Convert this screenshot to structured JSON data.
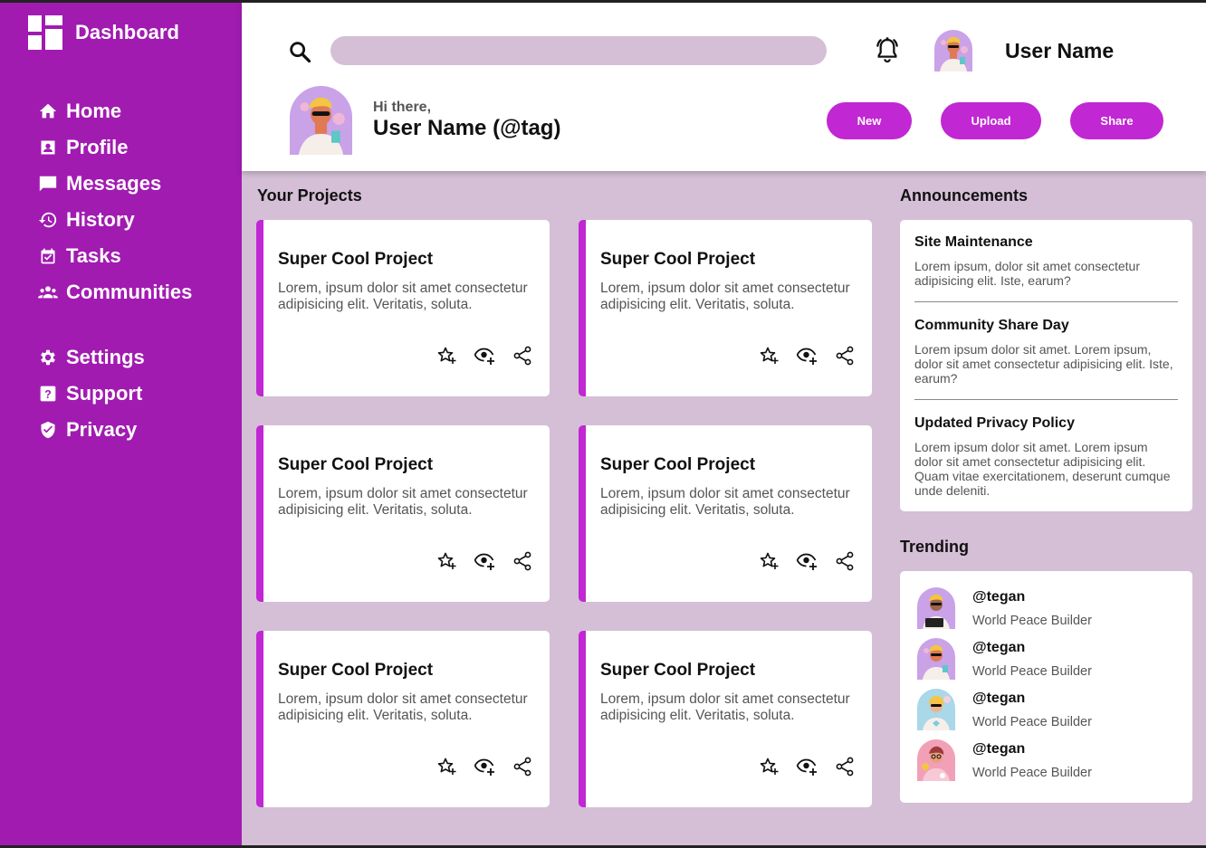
{
  "sidebar": {
    "brand": "Dashboard",
    "nav_main": [
      {
        "label": "Home",
        "icon": "home-icon"
      },
      {
        "label": "Profile",
        "icon": "profile-icon"
      },
      {
        "label": "Messages",
        "icon": "messages-icon"
      },
      {
        "label": "History",
        "icon": "history-icon"
      },
      {
        "label": "Tasks",
        "icon": "tasks-icon"
      },
      {
        "label": "Communities",
        "icon": "communities-icon"
      }
    ],
    "nav_secondary": [
      {
        "label": "Settings",
        "icon": "gear-icon"
      },
      {
        "label": "Support",
        "icon": "help-icon"
      },
      {
        "label": "Privacy",
        "icon": "shield-icon"
      }
    ]
  },
  "header": {
    "search_placeholder": "",
    "username": "User Name",
    "greeting": "Hi there,",
    "display_name": "User Name (@tag)",
    "buttons": {
      "new": "New",
      "upload": "Upload",
      "share": "Share"
    }
  },
  "projects": {
    "heading": "Your Projects",
    "items": [
      {
        "title": "Super Cool Project",
        "desc": "Lorem, ipsum dolor sit amet consectetur adipisicing elit. Veritatis, soluta."
      },
      {
        "title": "Super Cool Project",
        "desc": "Lorem, ipsum dolor sit amet consectetur adipisicing elit. Veritatis, soluta."
      },
      {
        "title": "Super Cool Project",
        "desc": "Lorem, ipsum dolor sit amet consectetur adipisicing elit. Veritatis, soluta."
      },
      {
        "title": "Super Cool Project",
        "desc": "Lorem, ipsum dolor sit amet consectetur adipisicing elit. Veritatis, soluta."
      },
      {
        "title": "Super Cool Project",
        "desc": "Lorem, ipsum dolor sit amet consectetur adipisicing elit. Veritatis, soluta."
      },
      {
        "title": "Super Cool Project",
        "desc": "Lorem, ipsum dolor sit amet consectetur adipisicing elit. Veritatis, soluta."
      }
    ]
  },
  "announcements": {
    "heading": "Announcements",
    "items": [
      {
        "title": "Site Maintenance",
        "body": "Lorem ipsum, dolor sit amet consectetur adipisicing elit. Iste, earum?"
      },
      {
        "title": "Community Share Day",
        "body": "Lorem ipsum dolor sit amet. Lorem ipsum, dolor sit amet consectetur adipisicing elit. Iste, earum?"
      },
      {
        "title": "Updated Privacy Policy",
        "body": "Lorem ipsum dolor sit amet. Lorem ipsum dolor sit amet consectetur adipisicing elit. Quam vitae exercitationem, deserunt cumque unde deleniti."
      }
    ]
  },
  "trending": {
    "heading": "Trending",
    "items": [
      {
        "handle": "@tegan",
        "subtitle": "World Peace Builder"
      },
      {
        "handle": "@tegan",
        "subtitle": "World Peace Builder"
      },
      {
        "handle": "@tegan",
        "subtitle": "World Peace Builder"
      },
      {
        "handle": "@tegan",
        "subtitle": "World Peace Builder"
      }
    ]
  },
  "colors": {
    "sidebar": "#a11bb1",
    "accent": "#c127d3",
    "background": "#d4bfd6"
  }
}
